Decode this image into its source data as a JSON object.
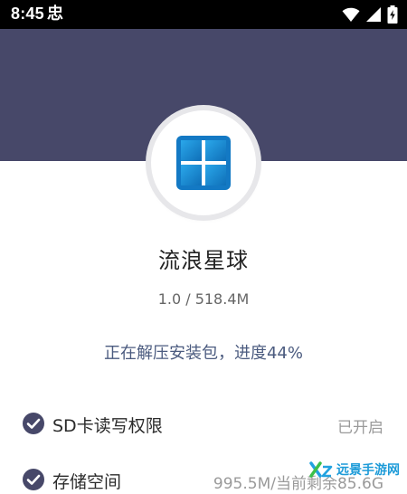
{
  "status_bar": {
    "time": "8:45",
    "app_notification_glyph": "忠",
    "icons": [
      "wifi-icon",
      "signal-icon",
      "battery-charging-icon"
    ]
  },
  "colors": {
    "header_band": "#474869",
    "accent_text": "#4b5b7f",
    "check_icon": "#474869",
    "status_text": "#9a9a9a"
  },
  "app": {
    "icon": "windows-logo-icon",
    "name": "流浪星球",
    "version_size": "1.0 / 518.4M",
    "progress_text": "正在解压安装包，进度44%",
    "progress_percent": 44
  },
  "permissions": [
    {
      "icon": "check-circle-icon",
      "label": "SD卡读写权限",
      "status": "已开启"
    },
    {
      "icon": "check-circle-icon",
      "label": "存储空间",
      "status": "995.5M/当前剩余85.6G"
    }
  ],
  "watermark": {
    "icon": "xz-logo-icon",
    "text": "远景手游网"
  }
}
